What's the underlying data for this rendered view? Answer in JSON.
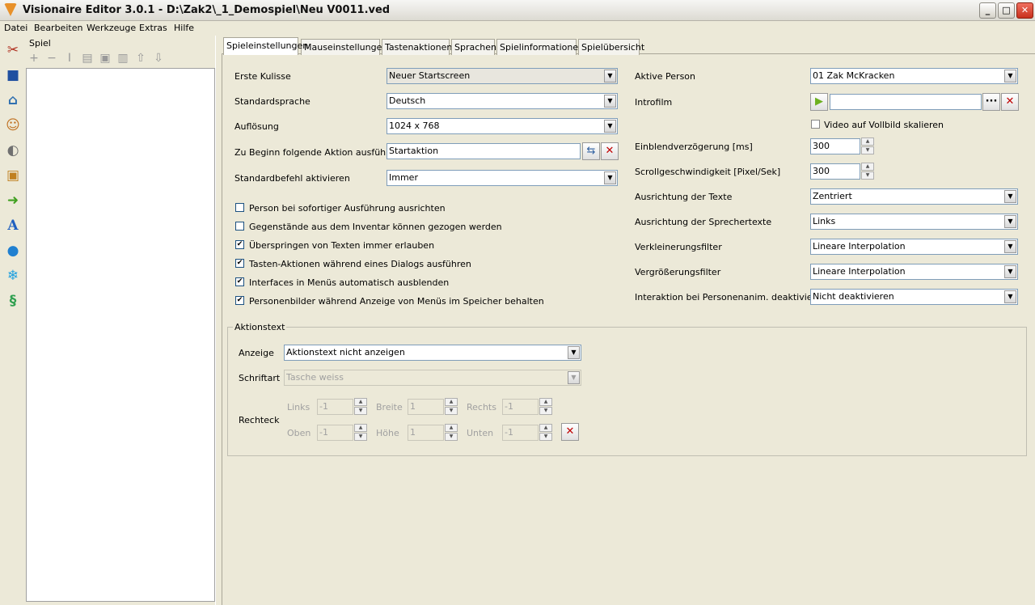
{
  "window": {
    "title": "Visionaire Editor 3.0.1 - D:\\Zak2\\_1_Demospiel\\Neu V0011.ved",
    "min": "_",
    "max": "□",
    "close": "✕"
  },
  "menu": [
    "Datei",
    "Bearbeiten",
    "Werkzeuge",
    "Extras",
    "Hilfe"
  ],
  "sidebar_icons": [
    "tools-icon",
    "save-icon",
    "house-icon",
    "people-icon",
    "mouse-icon",
    "box-icon",
    "arrow-icon",
    "font-icon",
    "speech-bubble-icon",
    "snowflake-icon",
    "scroll-icon"
  ],
  "panel": {
    "label": "Spiel",
    "toolbar": [
      "+",
      "−",
      "I",
      "▤",
      "▣",
      "▥",
      "⇧",
      "⇩"
    ]
  },
  "tabs": [
    "Spieleinstellungen",
    "Mauseinstellungen",
    "Tastenaktionen",
    "Sprachen",
    "Spielinformationen",
    "Spielübersicht"
  ],
  "left_form": {
    "erste_kulisse": {
      "label": "Erste Kulisse",
      "value": "Neuer Startscreen"
    },
    "standardsprache": {
      "label": "Standardsprache",
      "value": "Deutsch"
    },
    "aufloesung": {
      "label": "Auflösung",
      "value": "1024 x 768"
    },
    "beginn_aktion": {
      "label": "Zu Beginn folgende Aktion ausführen",
      "value": "Startaktion"
    },
    "standardbefehl": {
      "label": "Standardbefehl aktivieren",
      "value": "Immer"
    },
    "checkboxes": [
      {
        "label": "Person bei sofortiger Ausführung ausrichten",
        "checked": false
      },
      {
        "label": "Gegenstände aus dem Inventar können gezogen werden",
        "checked": false
      },
      {
        "label": "Überspringen von Texten immer erlauben",
        "checked": true
      },
      {
        "label": "Tasten-Aktionen während eines Dialogs ausführen",
        "checked": true
      },
      {
        "label": "Interfaces in Menüs automatisch ausblenden",
        "checked": true
      },
      {
        "label": "Personenbilder während Anzeige von Menüs im Speicher behalten",
        "checked": true
      }
    ]
  },
  "right_form": {
    "aktive_person": {
      "label": "Aktive Person",
      "value": "01 Zak McKracken"
    },
    "introfilm": {
      "label": "Introfilm",
      "value": "",
      "browse": "···",
      "clear": "✕",
      "play": "▶"
    },
    "vollbild": {
      "label": "Video auf Vollbild skalieren",
      "checked": false
    },
    "einblend": {
      "label": "Einblendverzögerung [ms]",
      "value": "300"
    },
    "scroll": {
      "label": "Scrollgeschwindigkeit [Pixel/Sek]",
      "value": "300"
    },
    "ausrichtung_texte": {
      "label": "Ausrichtung der Texte",
      "value": "Zentriert"
    },
    "ausrichtung_sprecher": {
      "label": "Ausrichtung der Sprechertexte",
      "value": "Links"
    },
    "verkleinerung": {
      "label": "Verkleinerungsfilter",
      "value": "Lineare Interpolation"
    },
    "vergroesserung": {
      "label": "Vergrößerungsfilter",
      "value": "Lineare Interpolation"
    },
    "interaktion": {
      "label": "Interaktion bei Personenanim. deaktivieren",
      "value": "Nicht deaktivieren"
    }
  },
  "aktionstext": {
    "title": "Aktionstext",
    "anzeige": {
      "label": "Anzeige",
      "value": "Aktionstext nicht anzeigen"
    },
    "schriftart": {
      "label": "Schriftart",
      "value": "Tasche weiss"
    },
    "rechteck": {
      "label": "Rechteck",
      "links": {
        "label": "Links",
        "value": "-1"
      },
      "breite": {
        "label": "Breite",
        "value": "1"
      },
      "rechts": {
        "label": "Rechts",
        "value": "-1"
      },
      "oben": {
        "label": "Oben",
        "value": "-1"
      },
      "hoehe": {
        "label": "Höhe",
        "value": "1"
      },
      "unten": {
        "label": "Unten",
        "value": "-1"
      }
    }
  },
  "glyphs": {
    "arrow_down": "▼",
    "spin_up": "▲",
    "spin_down": "▼",
    "check": "✔",
    "delete": "✕",
    "tree": "⇆"
  }
}
